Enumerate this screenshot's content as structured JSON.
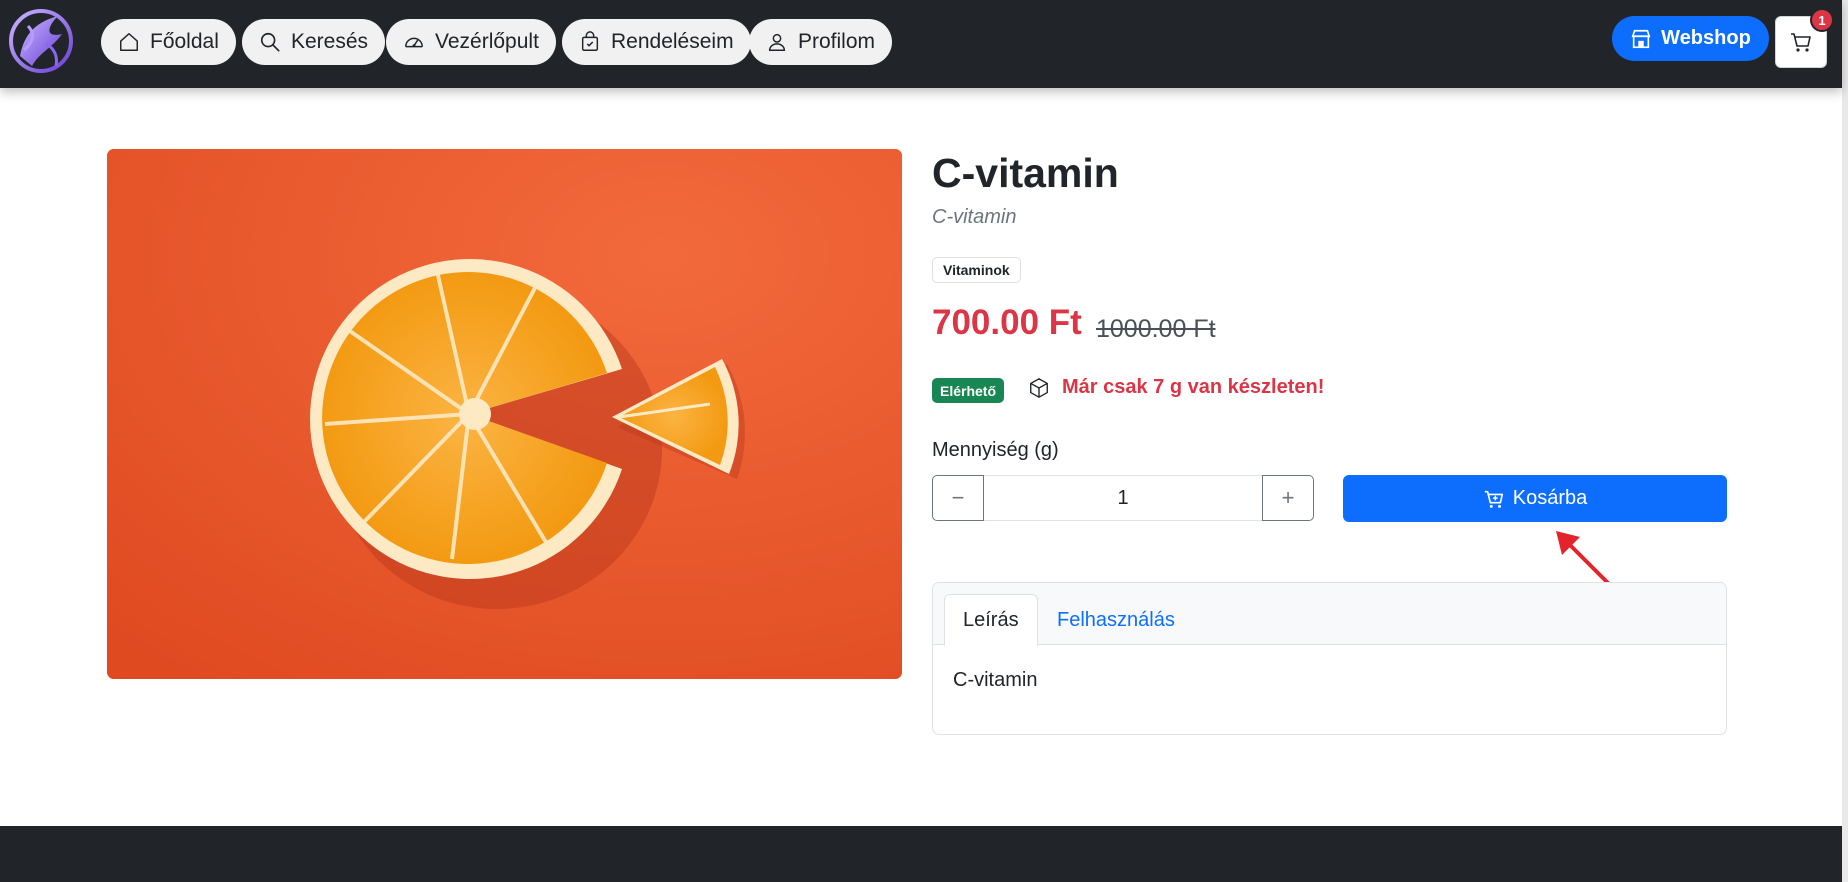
{
  "nav": {
    "items": [
      {
        "label": "Főoldal",
        "icon": "home-icon"
      },
      {
        "label": "Keresés",
        "icon": "search-icon"
      },
      {
        "label": "Vezérlőpult",
        "icon": "dashboard-icon"
      },
      {
        "label": "Rendeléseim",
        "icon": "orders-icon"
      },
      {
        "label": "Profilom",
        "icon": "user-icon"
      }
    ],
    "webshop_label": "Webshop",
    "cart_count": "1"
  },
  "product": {
    "title": "C-vitamin",
    "subtitle": "C-vitamin",
    "category": "Vitaminok",
    "price": "700.00 Ft",
    "old_price": "1000.00 Ft",
    "availability": "Elérhető",
    "stock_note": "Már csak 7 g van készleten!",
    "quantity_label": "Mennyiség (g)",
    "quantity_value": "1",
    "minus_label": "−",
    "plus_label": "+",
    "add_to_cart_label": "Kosárba"
  },
  "tabs": {
    "items": [
      {
        "label": "Leírás",
        "active": true
      },
      {
        "label": "Felhasználás",
        "active": false
      }
    ],
    "content": "C-vitamin"
  },
  "colors": {
    "navbar": "#212529",
    "primary": "#0d6efd",
    "price": "#dc3545",
    "success": "#198754",
    "image_background": "#e9532a"
  }
}
